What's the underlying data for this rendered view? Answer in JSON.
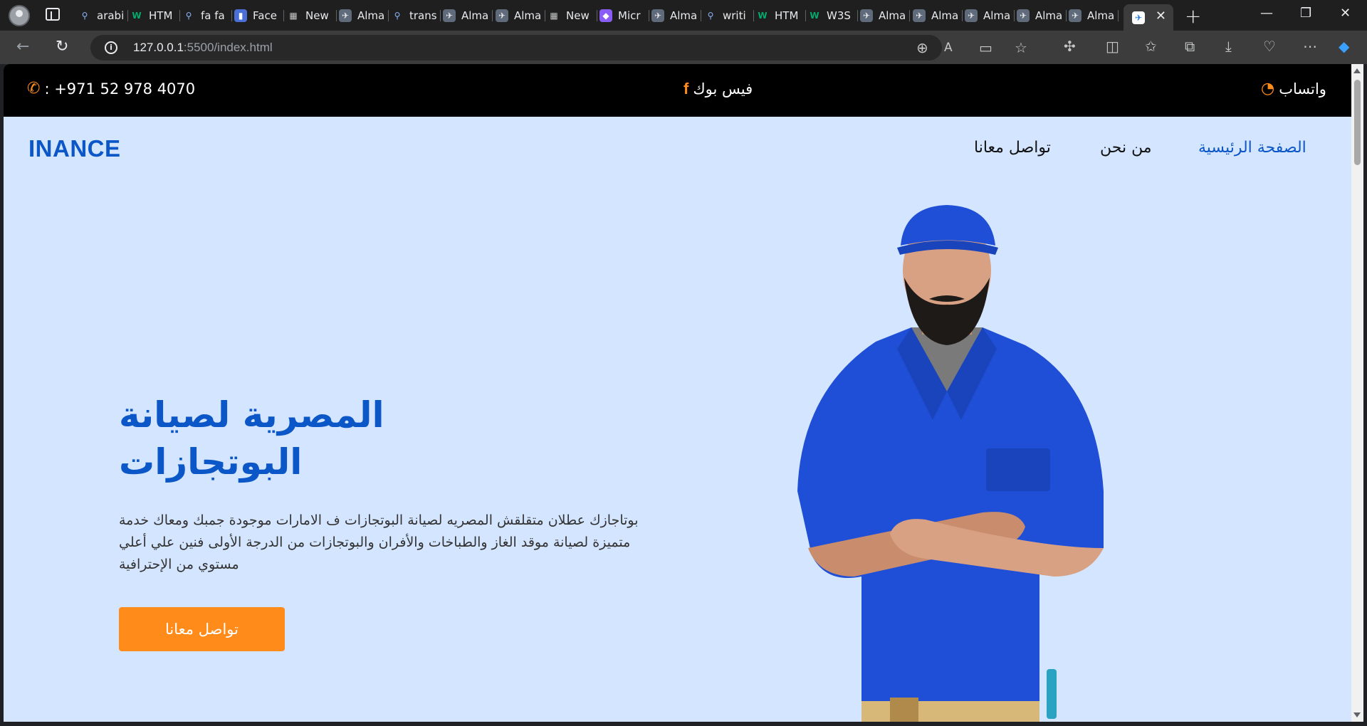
{
  "browser": {
    "tabs": [
      {
        "title": "arabi",
        "icon": "search-icon"
      },
      {
        "title": "HTM",
        "icon": "w3schools-icon"
      },
      {
        "title": "fa fa",
        "icon": "search-icon"
      },
      {
        "title": "Face",
        "icon": "bookmark-icon"
      },
      {
        "title": "New",
        "icon": "new-tab-icon"
      },
      {
        "title": "Alma",
        "icon": "plane-icon"
      },
      {
        "title": "trans",
        "icon": "search-icon"
      },
      {
        "title": "Alma",
        "icon": "plane-icon"
      },
      {
        "title": "Alma",
        "icon": "plane-icon"
      },
      {
        "title": "New",
        "icon": "new-tab-icon"
      },
      {
        "title": "Micr",
        "icon": "copilot-icon"
      },
      {
        "title": "Alma",
        "icon": "plane-icon"
      },
      {
        "title": "writi",
        "icon": "search-icon"
      },
      {
        "title": "HTM",
        "icon": "w3schools-icon"
      },
      {
        "title": "W3S",
        "icon": "w3schools-icon"
      },
      {
        "title": "Alma",
        "icon": "plane-icon"
      },
      {
        "title": "Alma",
        "icon": "plane-icon"
      },
      {
        "title": "Alma",
        "icon": "plane-icon"
      },
      {
        "title": "Alma",
        "icon": "plane-icon"
      },
      {
        "title": "Alma",
        "icon": "plane-icon"
      }
    ],
    "url_host": "127.0.0.1",
    "url_rest": ":5500/index.html"
  },
  "contact_bar": {
    "phone": ": +971 52 978 4070",
    "facebook": "فيس بوك",
    "whatsapp": "واتساب"
  },
  "navbar": {
    "brand": "INANCE",
    "links": [
      "الصفحة الرئيسية",
      "من نحن",
      "تواصل معانا"
    ]
  },
  "hero": {
    "title_line1": "المصرية لصيانة",
    "title_line2": "البوتجازات",
    "text": "بوتاجازك عطلان متقلقش المصريه لصيانة البوتجازات ف الامارات موجودة جمبك ومعاك خدمة متميزة لصيانة موقد الغاز والطباخات والأفران والبوتجازات من الدرجة الأولى فنين علي أعلي مستوي من الإحترافية",
    "button": "تواصل معانا"
  },
  "colors": {
    "accent_orange": "#ff8c1a",
    "brand_blue": "#0b57c7",
    "hero_bg": "#d4e5ff"
  }
}
